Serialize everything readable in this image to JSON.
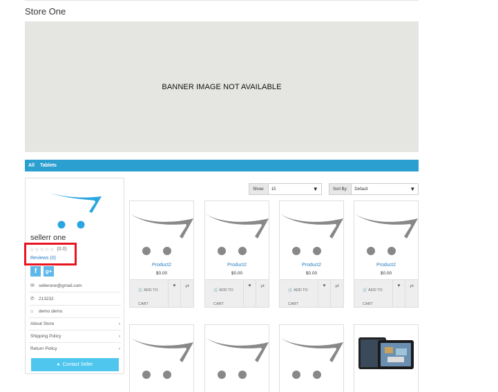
{
  "store": {
    "title": "Store One"
  },
  "banner": {
    "text": "BANNER IMAGE NOT AVAILABLE"
  },
  "categories": [
    "All",
    "Tablets"
  ],
  "seller": {
    "name": "sellerr one",
    "rating": "(0.0)",
    "reviews": "Reviews (0)",
    "social": [
      "f",
      "g+"
    ],
    "email": "sellerone@gmail.com",
    "phone": "213232",
    "address": "demo demo",
    "menu": [
      "About Store",
      "Shipping Policy",
      "Return Policy"
    ],
    "contact": "Contact Seller"
  },
  "toolbar": {
    "show_label": "Show:",
    "show_value": "15",
    "sort_label": "Sort By:",
    "sort_value": "Default"
  },
  "products": [
    {
      "name": "Product2",
      "price": "$0.00",
      "add_to_cart": "ADD TO CART"
    },
    {
      "name": "Product2",
      "price": "$0.00",
      "add_to_cart": "ADD TO CART"
    },
    {
      "name": "Product2",
      "price": "$0.00",
      "add_to_cart": "ADD TO CART"
    },
    {
      "name": "Product2",
      "price": "$0.00",
      "add_to_cart": "ADD TO CART"
    }
  ],
  "colors": {
    "accent": "#2a9fd0",
    "button": "#4fc6ee",
    "highlight": "#e8141f"
  }
}
